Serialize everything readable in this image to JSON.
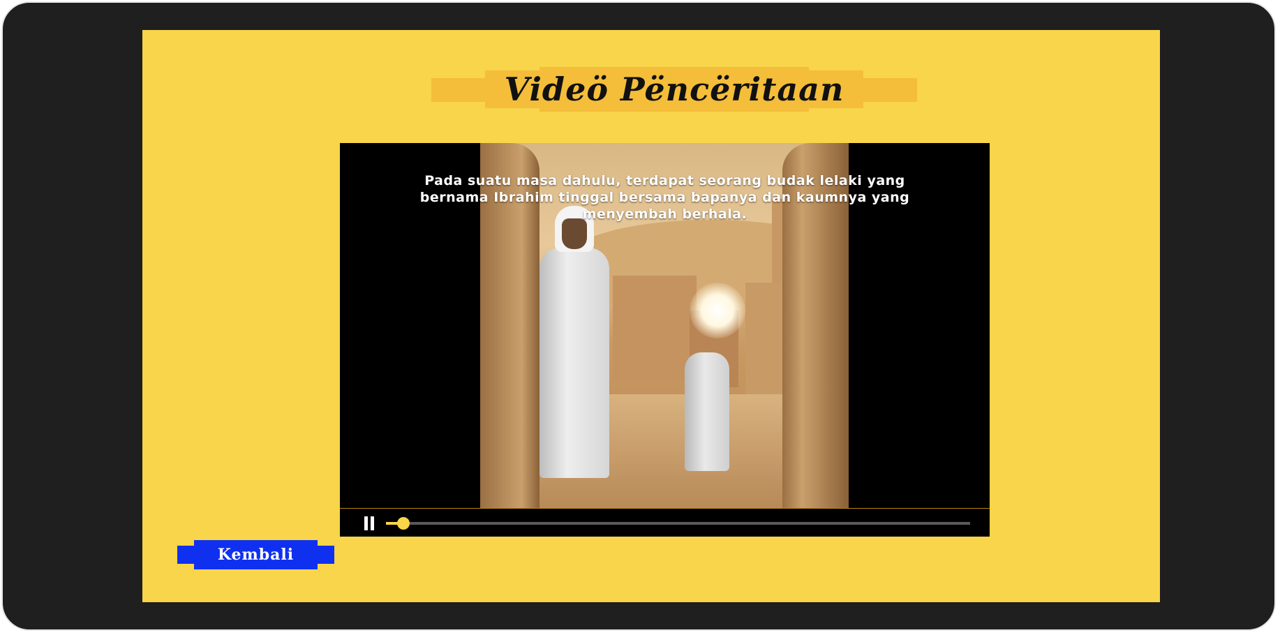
{
  "page": {
    "title": "Videö Pëncëritaan"
  },
  "video": {
    "caption": "Pada suatu masa dahulu, terdapat seorang budak lelaki yang bernama Ibrahim tinggal bersama bapanya dan kaumnya yang menyembah berhala.",
    "state": "playing",
    "progress_percent": 3,
    "play_pause_icon": "pause-icon"
  },
  "navigation": {
    "back_label": "Kembali"
  },
  "colors": {
    "background": "#f8d54a",
    "title_banner": "#f4bd3a",
    "back_button": "#1030f0",
    "progress_accent": "#f8d54a",
    "frame": "#1f1f1f"
  }
}
